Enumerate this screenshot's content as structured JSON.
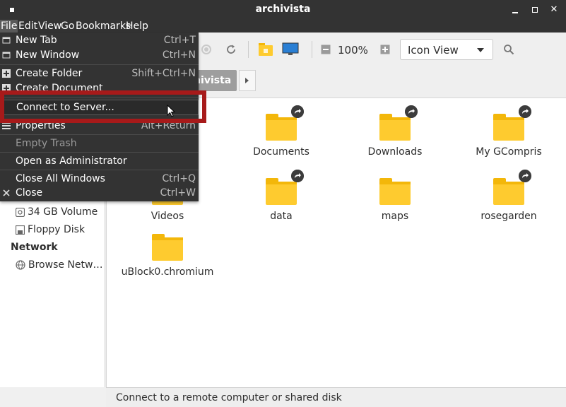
{
  "window": {
    "title": "archivista"
  },
  "menubar": {
    "items": [
      "File",
      "Edit",
      "View",
      "Go",
      "Bookmarks",
      "Help"
    ]
  },
  "file_menu": {
    "items": [
      {
        "label": "New Tab",
        "accel": "Ctrl+T",
        "icon": "new-tab-icon"
      },
      {
        "label": "New Window",
        "accel": "Ctrl+N",
        "icon": "new-window-icon"
      },
      {
        "label": "Create Folder",
        "accel": "Shift+Ctrl+N",
        "icon": "create-folder-icon"
      },
      {
        "label": "Create Document",
        "accel": "",
        "icon": "create-document-icon"
      },
      {
        "label": "Connect to Server...",
        "accel": "",
        "icon": ""
      },
      {
        "label": "Properties",
        "accel": "Alt+Return",
        "icon": "properties-icon"
      },
      {
        "label": "Empty Trash",
        "accel": "",
        "icon": ""
      },
      {
        "label": "Open as Administrator",
        "accel": "",
        "icon": ""
      },
      {
        "label": "Close All Windows",
        "accel": "Ctrl+Q",
        "icon": ""
      },
      {
        "label": "Close",
        "accel": "Ctrl+W",
        "icon": "close-icon"
      }
    ]
  },
  "toolbar": {
    "zoom": "100%",
    "view_mode": "Icon View"
  },
  "pathbar": {
    "current": "chivista"
  },
  "sidebar": {
    "devices": [
      {
        "label": "34 GB Volume",
        "icon": "drive-icon"
      },
      {
        "label": "Floppy Disk",
        "icon": "floppy-icon"
      }
    ],
    "network_heading": "Network",
    "network": [
      {
        "label": "Browse Netw…",
        "icon": "network-icon"
      }
    ]
  },
  "files": [
    {
      "name": "Documents",
      "link": true
    },
    {
      "name": "Downloads",
      "link": true
    },
    {
      "name": "My GCompris",
      "link": true
    },
    {
      "name": "Videos",
      "link": false
    },
    {
      "name": "data",
      "link": true
    },
    {
      "name": "maps",
      "link": false
    },
    {
      "name": "rosegarden",
      "link": true
    },
    {
      "name": "uBlock0.chromium",
      "link": false
    }
  ],
  "statusbar": {
    "text": "Connect to a remote computer or shared disk"
  },
  "colors": {
    "menu_bg": "#333333",
    "folder": "#fecb2f",
    "highlight": "#a71a1a"
  }
}
